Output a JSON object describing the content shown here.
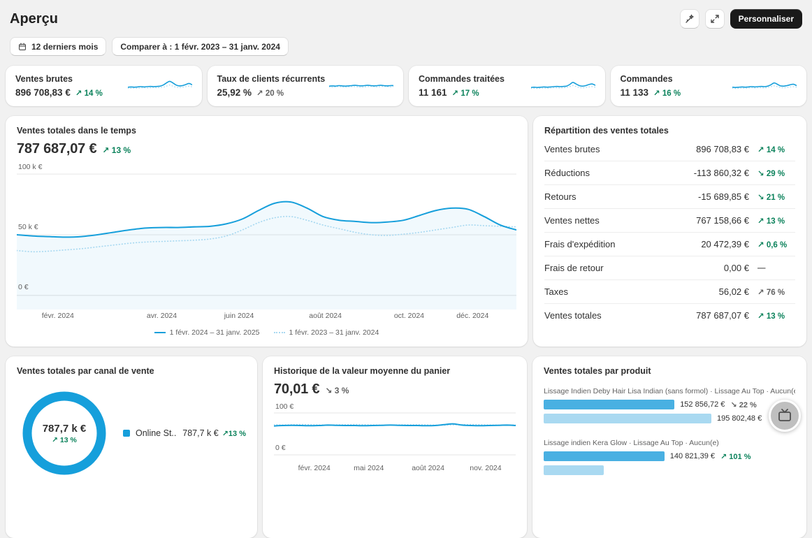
{
  "page": {
    "title": "Aperçu"
  },
  "header": {
    "personalize_button": "Personnaliser"
  },
  "filters": {
    "period": "12 derniers mois",
    "compare": "Comparer à : 1 févr. 2023 – 31 janv. 2024"
  },
  "colors": {
    "accent_blue": "#169fdb",
    "compare_blue": "#a9d9f1",
    "bar_current": "#49b0e2",
    "bar_previous": "#a9d9f1",
    "positive_green": "#0b825b",
    "neutral_gray": "#616161",
    "button_black": "#1a1a1a"
  },
  "kpis": [
    {
      "label": "Ventes brutes",
      "value": "896 708,83 €",
      "delta": "↗ 14 %",
      "tone": "positive",
      "spark": {
        "current": [
          12,
          12.5,
          12,
          12.5,
          13,
          12.5,
          13,
          13.5,
          13,
          13.5,
          14,
          16,
          20,
          23,
          20,
          16,
          14.5,
          15,
          17,
          19,
          16.5
        ],
        "previous": [
          10,
          10,
          10.5,
          10,
          10.5,
          11,
          10.5,
          11,
          11.5,
          11,
          11.5,
          12,
          14,
          16,
          14,
          12,
          11.5,
          12,
          13,
          14,
          12.5
        ]
      }
    },
    {
      "label": "Taux de clients récurrents",
      "value": "25,92 %",
      "delta": "↗ 20 %",
      "tone": "neutral",
      "spark": {
        "current": [
          14,
          14.5,
          14,
          15,
          14.5,
          14,
          14.5,
          15,
          15.5,
          15,
          14.5,
          15,
          15.5,
          15,
          14.5,
          15,
          15.5,
          15,
          14.5,
          15,
          15
        ],
        "previous": [
          12.5,
          12,
          12.5,
          13,
          12.5,
          12,
          12.5,
          13,
          13,
          12.5,
          12,
          12.5,
          13,
          13.5,
          13,
          12.5,
          13,
          13.5,
          13,
          12.5,
          13
        ]
      }
    },
    {
      "label": "Commandes traitées",
      "value": "11 161",
      "delta": "↗ 17 %",
      "tone": "positive",
      "spark": {
        "current": [
          11.5,
          12,
          11.5,
          12,
          12.5,
          12,
          12.5,
          13,
          13.5,
          13,
          13.5,
          14,
          17,
          21,
          18,
          15,
          14,
          15,
          17,
          18,
          15.5
        ],
        "previous": [
          9.5,
          10,
          9.5,
          10,
          10.5,
          10,
          10.5,
          11,
          11,
          10.5,
          11,
          11.5,
          13,
          15,
          13.5,
          11.5,
          11,
          11.5,
          12.5,
          13,
          12
        ]
      }
    },
    {
      "label": "Commandes",
      "value": "11 133",
      "delta": "↗ 16 %",
      "tone": "positive",
      "spark": {
        "current": [
          12,
          11.5,
          12,
          12.5,
          12,
          12.5,
          13,
          12.5,
          13,
          13.5,
          13,
          14,
          16.5,
          20,
          17.5,
          14.5,
          14,
          15,
          16.5,
          17.5,
          15
        ],
        "previous": [
          10,
          9.5,
          10,
          10.5,
          10,
          10.5,
          11,
          10.5,
          11,
          11,
          10.5,
          11.5,
          13,
          14.5,
          13,
          11.5,
          11,
          11.5,
          12.5,
          13,
          12
        ]
      }
    }
  ],
  "sales_over_time": {
    "title": "Ventes totales dans le temps",
    "value": "787 687,07 €",
    "delta": "↗ 13 %",
    "tone": "positive",
    "y_labels": [
      "100 k €",
      "50 k €",
      "0 €"
    ],
    "x_labels": [
      "févr. 2024",
      "avr. 2024",
      "juin 2024",
      "août 2024",
      "oct. 2024",
      "déc. 2024"
    ],
    "legend": [
      {
        "label": "1 févr. 2024 – 31 janv. 2025",
        "style": "solid"
      },
      {
        "label": "1 févr. 2023 – 31 janv. 2024",
        "style": "dotted"
      }
    ],
    "chart": {
      "type": "line",
      "unit": "k€",
      "y_range": [
        0,
        100
      ],
      "current": [
        50,
        49,
        48.5,
        48,
        48.5,
        50,
        52,
        54,
        55.5,
        56,
        56,
        56.5,
        57,
        59,
        63,
        70,
        76,
        77,
        72,
        65,
        62,
        61,
        60,
        60.5,
        62,
        66,
        70,
        72,
        71,
        65,
        58,
        54
      ],
      "previous": [
        37,
        36,
        36.5,
        37.5,
        38.5,
        40,
        41.5,
        43,
        44,
        44.5,
        45,
        45.5,
        46.5,
        49,
        54,
        60,
        64,
        65,
        62,
        58,
        55,
        52,
        50,
        49.5,
        50.5,
        52,
        54,
        56,
        58,
        57.5,
        57,
        56.5
      ]
    }
  },
  "breakdown": {
    "title": "Répartition des ventes totales",
    "rows": [
      {
        "label": "Ventes brutes",
        "value": "896 708,83 €",
        "delta": "↗ 14 %",
        "tone": "positive"
      },
      {
        "label": "Réductions",
        "value": "-113 860,32 €",
        "delta": "↘ 29 %",
        "tone": "positive"
      },
      {
        "label": "Retours",
        "value": "-15 689,85 €",
        "delta": "↘ 21 %",
        "tone": "positive"
      },
      {
        "label": "Ventes nettes",
        "value": "767 158,66 €",
        "delta": "↗ 13 %",
        "tone": "positive"
      },
      {
        "label": "Frais d'expédition",
        "value": "20 472,39 €",
        "delta": "↗ 0,6 %",
        "tone": "positive"
      },
      {
        "label": "Frais de retour",
        "value": "0,00 €",
        "delta": "—",
        "tone": "none"
      },
      {
        "label": "Taxes",
        "value": "56,02 €",
        "delta": "↗ 76 %",
        "tone": "neutral"
      },
      {
        "label": "Ventes totales",
        "value": "787 687,07 €",
        "delta": "↗ 13 %",
        "tone": "positive"
      }
    ]
  },
  "channel": {
    "title": "Ventes totales par canal de vente",
    "center": {
      "value": "787,7 k €",
      "delta": "↗ 13 %",
      "tone": "positive"
    },
    "legend": {
      "label": "Online St...",
      "value": "787,7 k €",
      "delta": "↗13 %",
      "tone": "positive"
    },
    "chart": {
      "type": "donut",
      "segments": [
        {
          "name": "Online Store",
          "display_value": "787,7 k €",
          "fraction": 1.0
        }
      ]
    }
  },
  "aov": {
    "title": "Historique de la valeur moyenne du panier",
    "value": "70,01 €",
    "delta": "↘ 3 %",
    "tone": "neutral",
    "y_labels": [
      "100 €",
      "0 €"
    ],
    "x_labels": [
      "févr. 2024",
      "mai 2024",
      "août 2024",
      "nov. 2024"
    ],
    "chart": {
      "type": "line",
      "unit": "€",
      "y_range": [
        0,
        100
      ],
      "current": [
        69,
        70,
        70.5,
        70,
        69.5,
        70,
        71,
        70.5,
        70,
        70,
        69.5,
        70,
        70.5,
        71,
        70.5,
        70,
        70,
        69.5,
        70,
        72,
        74,
        71,
        70,
        69.5,
        70,
        70.5,
        71,
        70
      ],
      "previous": [
        72,
        71.5,
        72,
        72.5,
        72,
        71.5,
        71,
        71.5,
        72,
        72.5,
        72,
        71.5,
        71,
        71,
        71.5,
        72,
        72,
        71.5,
        71,
        71,
        71.5,
        72,
        72.5,
        72,
        71.5,
        71,
        71,
        71.5
      ]
    }
  },
  "products": {
    "title": "Ventes totales par produit",
    "items": [
      {
        "label": "Lissage Indien Deby Hair Lisa Indian (sans formol) · Lissage Au Top · Aucun(e)",
        "current": {
          "value": "152 856,72 €",
          "delta": "↘ 22 %",
          "tone": "neutral",
          "percent": 78
        },
        "previous": {
          "value": "195 802,48 €",
          "percent": 100
        }
      },
      {
        "label": "Lissage indien Kera Glow · Lissage Au Top · Aucun(e)",
        "current": {
          "value": "140 821,39 €",
          "delta": "↗ 101 %",
          "tone": "positive",
          "percent": 72
        },
        "previous": {
          "value": "",
          "percent": 36
        }
      }
    ]
  }
}
